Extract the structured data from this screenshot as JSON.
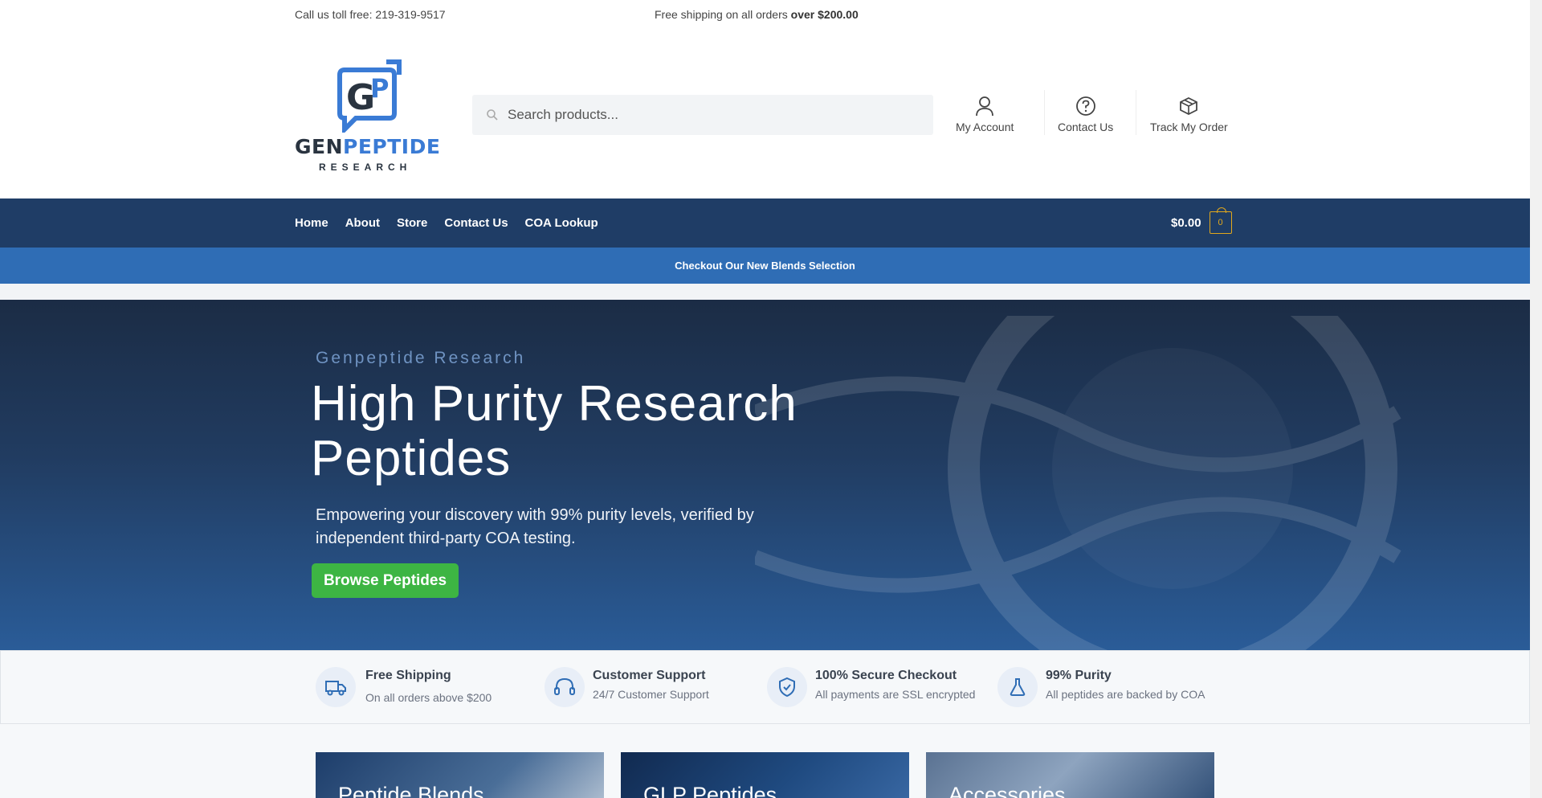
{
  "topbar": {
    "phone": "Call us toll free: 219-319-9517",
    "promo_prefix": "Free  shipping on all orders ",
    "promo_bold": "over $200.00"
  },
  "logo": {
    "monogram": "GP",
    "word_dark": "GEN",
    "word_blue": "PEPTIDE",
    "sub": "RESEARCH"
  },
  "search": {
    "placeholder": "Search products..."
  },
  "header_nav": [
    {
      "label": "My Account",
      "icon": "user-icon"
    },
    {
      "label": "Contact Us",
      "icon": "help-circle-icon"
    },
    {
      "label": "Track My Order",
      "icon": "package-icon"
    }
  ],
  "navbar": {
    "links": [
      "Home",
      "About",
      "Store",
      "Contact Us",
      "COA Lookup"
    ],
    "cart_amount": "$0.00",
    "cart_count": "0"
  },
  "announcement": "Checkout Our New Blends Selection",
  "hero": {
    "eyebrow": "Genpeptide Research",
    "title": "High Purity Research Peptides",
    "lead": "Empowering your discovery with 99% purity levels, verified by independent third-party COA testing.",
    "cta": "Browse Peptides"
  },
  "features": [
    {
      "title": "Free Shipping",
      "subtitle": "On all orders above $200",
      "icon": "truck-icon"
    },
    {
      "title": "Customer Support",
      "subtitle": "24/7 Customer Support",
      "icon": "headset-icon"
    },
    {
      "title": "100% Secure Checkout",
      "subtitle": "All payments are SSL encrypted",
      "icon": "shield-check-icon"
    },
    {
      "title": "99% Purity",
      "subtitle": "All peptides are backed by COA",
      "icon": "flask-icon"
    }
  ],
  "categories": [
    {
      "title": "Peptide Blends"
    },
    {
      "title": "GLP Peptides"
    },
    {
      "title": "Accessories"
    }
  ],
  "colors": {
    "navbar": "#1f3d66",
    "announcement": "#2f6db5",
    "cta": "#3db543",
    "brand_blue": "#3a7bd5",
    "cart_badge": "#e2a81c"
  }
}
